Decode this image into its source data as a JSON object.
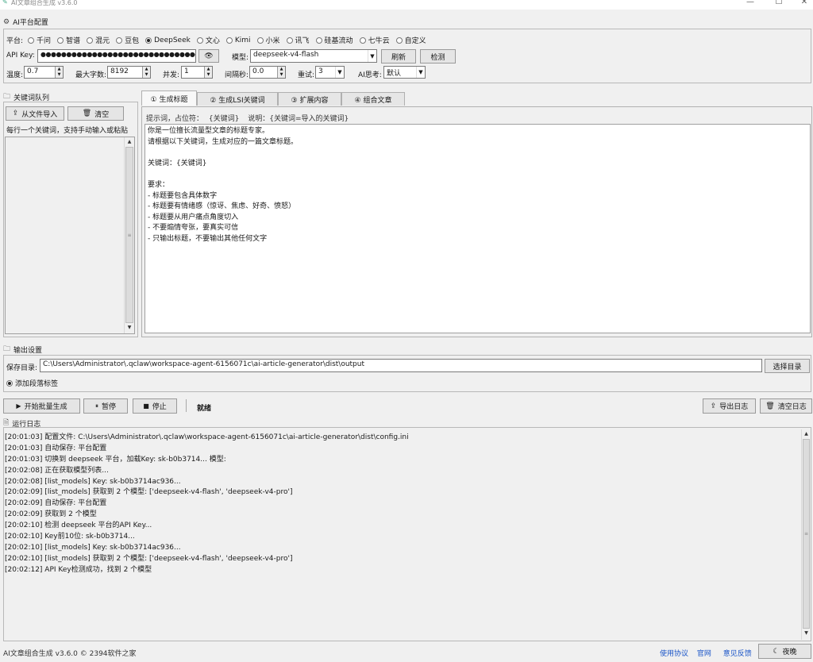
{
  "window": {
    "title": "AI文章组合生成 v3.6.0",
    "minimize_glyph": "—",
    "maximize_glyph": "☐",
    "close_glyph": "✕"
  },
  "ai_config": {
    "section_title": "AI平台配置",
    "platform_label": "平台:",
    "platforms": [
      "千问",
      "智谱",
      "混元",
      "豆包",
      "DeepSeek",
      "文心",
      "Kimi",
      "小米",
      "讯飞",
      "硅基流动",
      "七牛云",
      "自定义"
    ],
    "selected_platform": "DeepSeek",
    "api_key_label": "API Key:",
    "api_key_value": "●●●●●●●●●●●●●●●●●●●●●●●●●●●●●●●●●●●",
    "model_label": "模型:",
    "model_value": "deepseek-v4-flash",
    "refresh_label": "刷新",
    "check_label": "检测",
    "temperature_label": "温度:",
    "temperature_value": "0.7",
    "max_chars_label": "最大字数:",
    "max_chars_value": "8192",
    "concurrency_label": "并发:",
    "concurrency_value": "1",
    "interval_label": "间隔秒:",
    "interval_value": "0.0",
    "retry_label": "重试:",
    "retry_value": "3",
    "ai_think_label": "AI思考:",
    "ai_think_value": "默认"
  },
  "keyword_queue": {
    "section_title": "关键词队列",
    "import_label": "从文件导入",
    "clear_label": "清空",
    "hint": "每行一个关键词，支持手动输入或粘贴"
  },
  "tabs": [
    {
      "label": "① 生成标题"
    },
    {
      "label": "② 生成LSI关键词"
    },
    {
      "label": "③ 扩展内容"
    },
    {
      "label": "④ 组合文章"
    }
  ],
  "prompt": {
    "hint_label": "提示词，占位符：",
    "placeholder_tag": "{关键词}",
    "description": "说明：{关键词=导入的关键词}",
    "lines": [
      "你是一位擅长流量型文章的标题专家。",
      "请根据以下关键词，生成对应的一篇文章标题。",
      "",
      "关键词：{关键词}",
      "",
      "要求：",
      "- 标题要包含具体数字",
      "- 标题要有情绪感（惊讶、焦虑、好奇、愤怒）",
      "- 标题要从用户痛点角度切入",
      "- 不要煽情夸张，要真实可信",
      "- 只输出标题，不要输出其他任何文字"
    ]
  },
  "output": {
    "section_title": "输出设置",
    "save_dir_label": "保存目录:",
    "save_dir_value": "C:\\Users\\Administrator\\.qclaw\\workspace-agent-6156071c\\ai-article-generator\\dist\\output",
    "choose_dir_label": "选择目录",
    "add_paragraph_tag_label": "添加段落标签"
  },
  "controls": {
    "start_label": "开始批量生成",
    "pause_label": "暂停",
    "stop_label": "停止",
    "status": "就绪",
    "export_log_label": "导出日志",
    "clear_log_label": "清空日志"
  },
  "log": {
    "section_title": "运行日志",
    "lines": [
      "[20:01:03] 配置文件: C:\\Users\\Administrator\\.qclaw\\workspace-agent-6156071c\\ai-article-generator\\dist\\config.ini",
      "[20:01:03] 自动保存: 平台配置",
      "[20:01:03] 切换到 deepseek 平台，加载Key: sk-b0b3714... 模型:",
      "[20:02:08] 正在获取模型列表...",
      "[20:02:08] [list_models] Key: sk-b0b3714ac936...",
      "[20:02:09] [list_models] 获取到 2 个模型: ['deepseek-v4-flash', 'deepseek-v4-pro']",
      "[20:02:09] 自动保存: 平台配置",
      "[20:02:09] 获取到 2 个模型",
      "[20:02:10] 检测 deepseek 平台的API Key...",
      "[20:02:10] Key前10位: sk-b0b3714...",
      "[20:02:10] [list_models] Key: sk-b0b3714ac936...",
      "[20:02:10] [list_models] 获取到 2 个模型: ['deepseek-v4-flash', 'deepseek-v4-pro']",
      "[20:02:12] API Key检测成功，找到 2 个模型"
    ]
  },
  "footer": {
    "app_info": "AI文章组合生成 v3.6.0  © 2394软件之家",
    "terms_label": "使用协议",
    "website_label": "官网",
    "feedback_label": "意见反馈",
    "night_mode_label": "夜晚"
  },
  "icons": {
    "settings": "gear-icon",
    "folder": "folder-icon",
    "upload": "upload-icon",
    "trash": "trash-icon",
    "eye": "eye-icon",
    "play": "play-icon",
    "pause": "pause-icon",
    "stop": "stop-icon",
    "log": "document-icon",
    "moon": "moon-icon"
  }
}
